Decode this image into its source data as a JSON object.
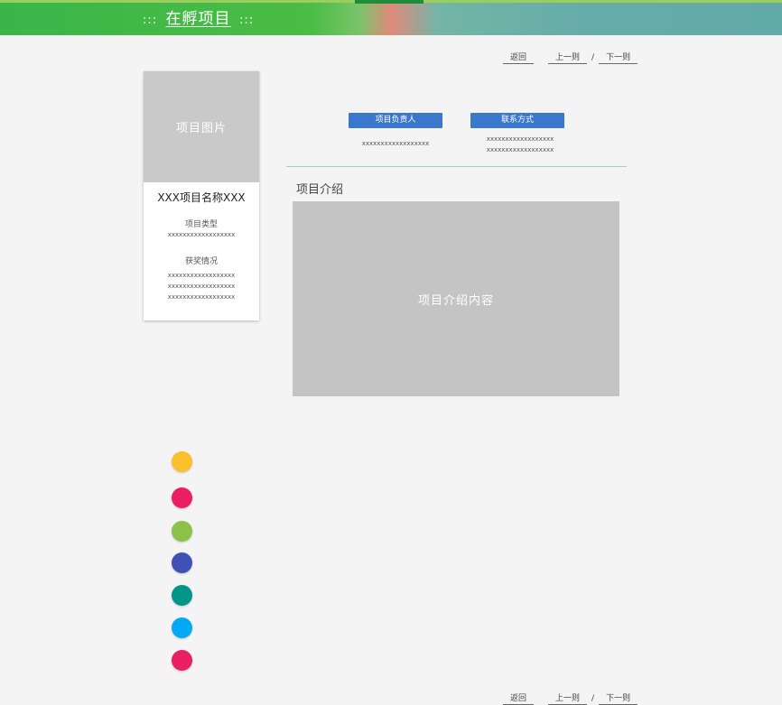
{
  "header": {
    "dots_left": ":::",
    "title": "在孵项目",
    "dots_right": ":::"
  },
  "nav": {
    "back": "返回",
    "prev": "上一则",
    "separator": "/",
    "next": "下一则"
  },
  "project_card": {
    "image_placeholder": "项目图片",
    "name": "XXX项目名称XXX",
    "type_label": "项目类型",
    "type_value": "xxxxxxxxxxxxxxxxxx",
    "awards_label": "获奖情况",
    "awards_values": [
      "xxxxxxxxxxxxxxxxxx",
      "xxxxxxxxxxxxxxxxxx",
      "xxxxxxxxxxxxxxxxxx"
    ]
  },
  "contacts": {
    "leader_button": "项目负责人",
    "leader_value": "xxxxxxxxxxxxxxxxxx",
    "contact_button": "联系方式",
    "contact_values": [
      "xxxxxxxxxxxxxxxxxx",
      "xxxxxxxxxxxxxxxxxx"
    ]
  },
  "intro": {
    "title": "项目介绍",
    "content_placeholder": "项目介绍内容"
  },
  "color_dots": [
    {
      "color": "#fbc02d"
    },
    {
      "color": "#e91e63"
    },
    {
      "color": "#8bc34a"
    },
    {
      "color": "#3f51b5"
    },
    {
      "color": "#009688"
    },
    {
      "color": "#03a9f4"
    },
    {
      "color": "#e91e63"
    }
  ]
}
